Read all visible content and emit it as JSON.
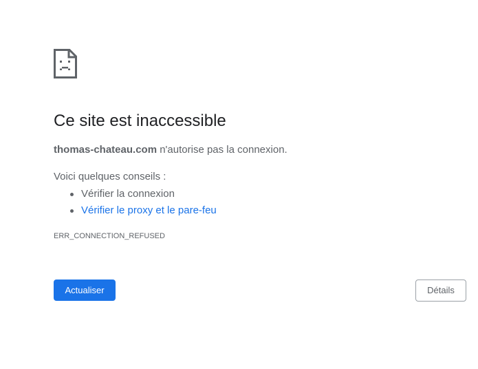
{
  "error_page": {
    "icon": "sad-page-icon",
    "title": "Ce site est inaccessible",
    "host": "thomas-chateau.com",
    "summary_suffix": " n'autorise pas la connexion.",
    "suggestions_intro": "Voici quelques conseils :",
    "suggestions": [
      {
        "label": "Vérifier la connexion",
        "is_link": false
      },
      {
        "label": "Vérifier le proxy et le pare-feu",
        "is_link": true
      }
    ],
    "error_code": "ERR_CONNECTION_REFUSED",
    "reload_button": "Actualiser",
    "details_button": "Détails"
  },
  "colors": {
    "accent": "#1a73e8",
    "text_primary": "#202124",
    "text_secondary": "#5f6368",
    "button_border": "#9aa0a6"
  }
}
